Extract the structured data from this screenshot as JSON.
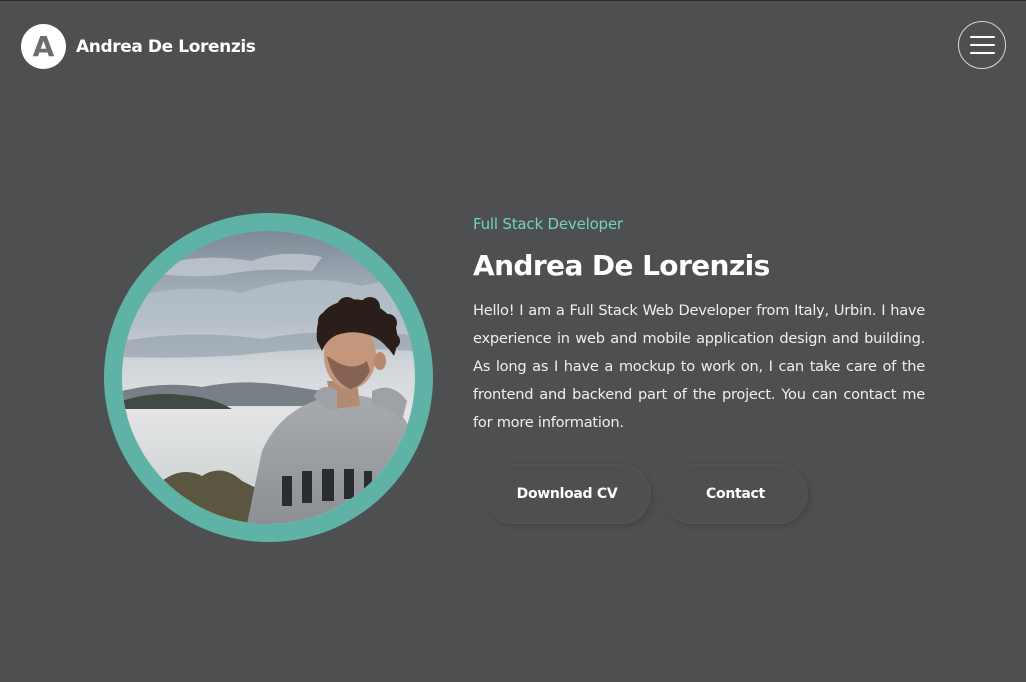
{
  "header": {
    "logo_letter": "A",
    "brand_name": "Andrea De Lorenzis"
  },
  "hero": {
    "subtitle": "Full Stack Developer",
    "title": "Andrea De Lorenzis",
    "bio": "Hello! I am a Full Stack Web Developer from Italy, Urbin. I have experience in web and mobile application design and building. As long as I have a mockup to work on, I can take care of the frontend and backend part of the project. You can contact me for more information.",
    "buttons": {
      "download_cv": "Download CV",
      "contact": "Contact"
    }
  },
  "colors": {
    "background": "#4e4f51",
    "accent": "#5fb3a6",
    "subtitle": "#6fd5c2",
    "text": "#ffffff"
  },
  "icons": {
    "menu": "hamburger-menu-icon",
    "logo": "logo-a-icon"
  }
}
